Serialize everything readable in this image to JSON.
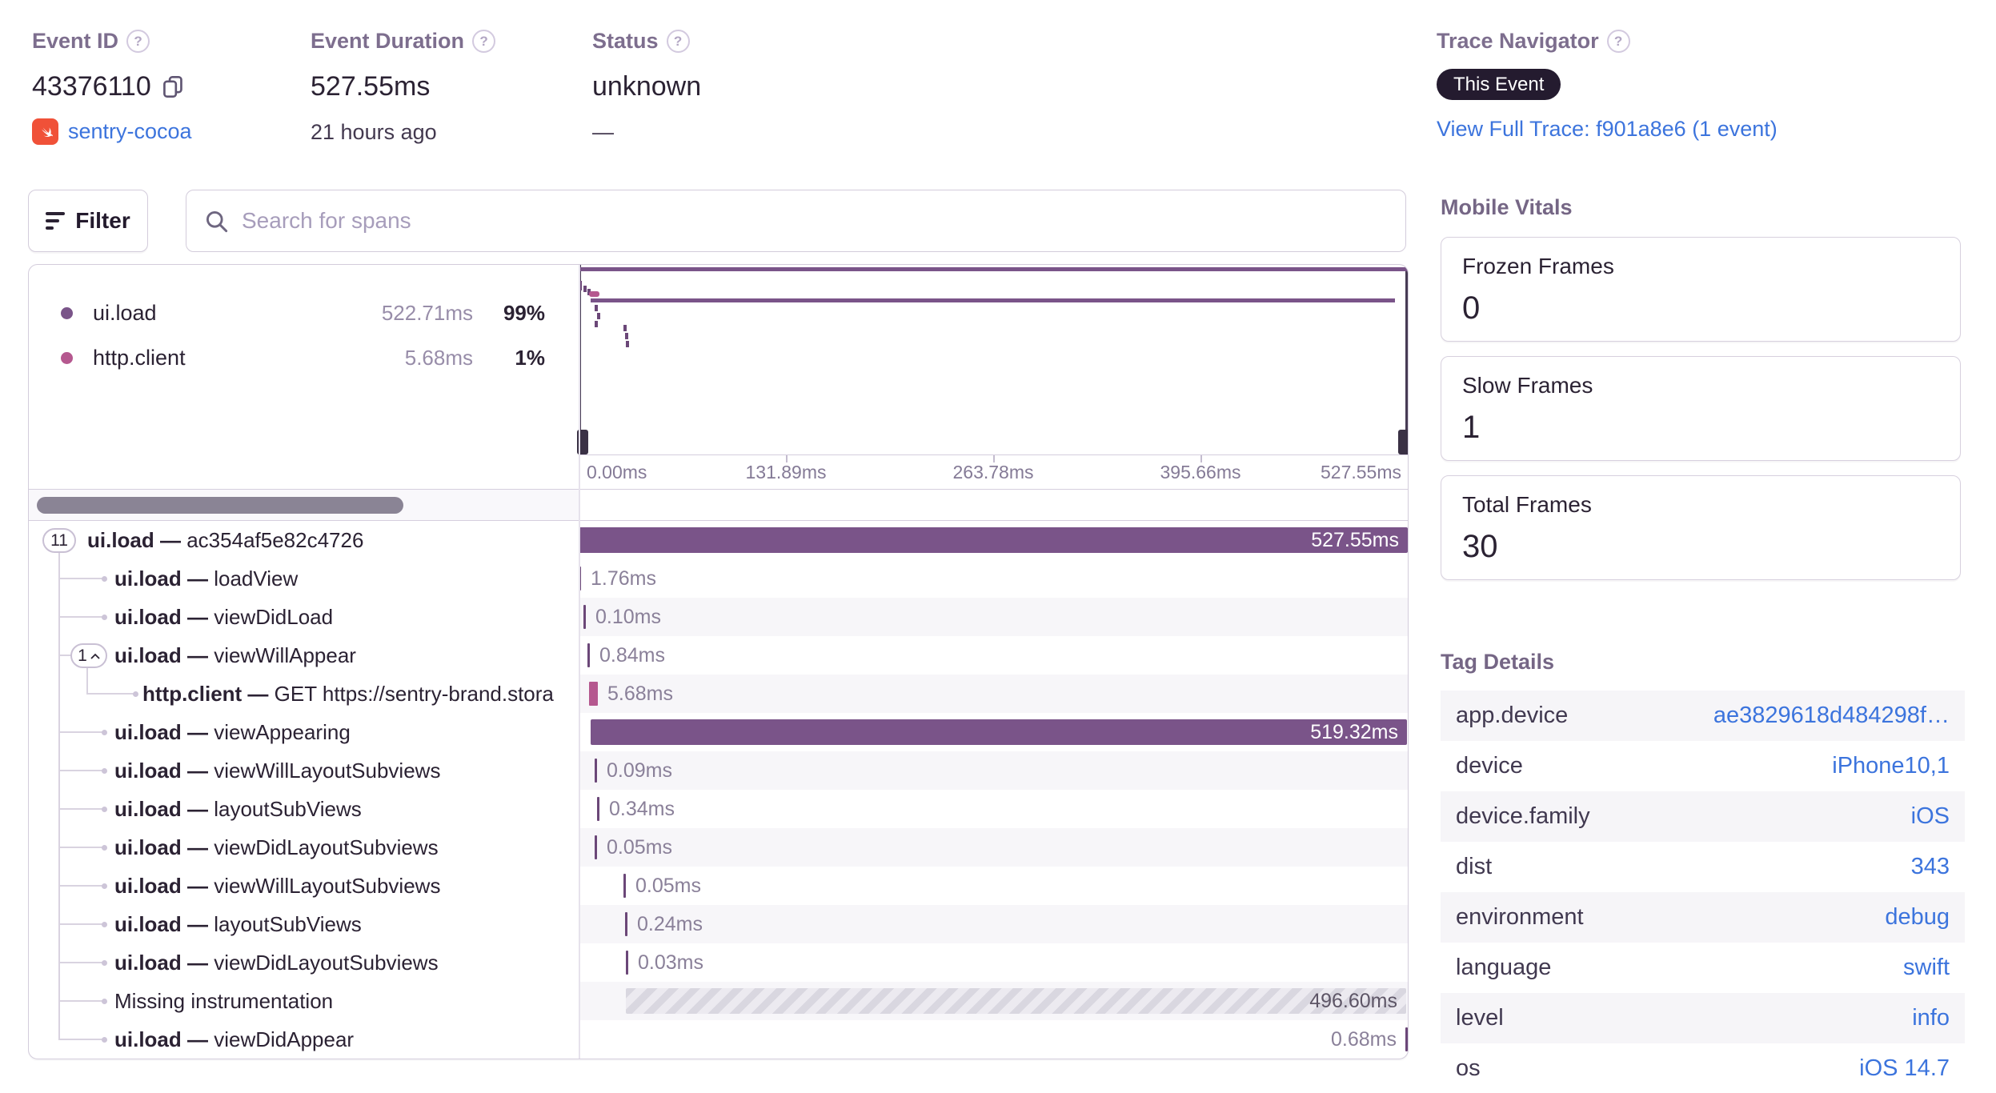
{
  "header": {
    "event_id": {
      "label": "Event ID",
      "value": "43376110",
      "project": "sentry-cocoa"
    },
    "event_duration": {
      "label": "Event Duration",
      "value": "527.55ms",
      "age": "21 hours ago"
    },
    "status": {
      "label": "Status",
      "value": "unknown",
      "sub": "—"
    },
    "trace_navigator": {
      "label": "Trace Navigator",
      "badge": "This Event",
      "link": "View Full Trace: f901a8e6 (1 event)"
    }
  },
  "toolbar": {
    "filter_label": "Filter",
    "search_placeholder": "Search for spans"
  },
  "chart_data": {
    "type": "span-waterfall",
    "total_ms": 527.55,
    "axis_ticks": [
      "0.00ms",
      "131.89ms",
      "263.78ms",
      "395.66ms",
      "527.55ms"
    ],
    "legend": [
      {
        "op": "ui.load",
        "duration": "522.71ms",
        "pct": "99%",
        "color": "#7a5489"
      },
      {
        "op": "http.client",
        "duration": "5.68ms",
        "pct": "1%",
        "color": "#b5588f"
      }
    ],
    "spans": [
      {
        "op": "ui.load",
        "desc": "ac354af5e82c4726",
        "duration_label": "527.55ms",
        "duration_ms": 527.55,
        "start_ms": 0,
        "kind": "bar",
        "pill": "11"
      },
      {
        "op": "ui.load",
        "desc": "loadView",
        "duration_label": "1.76ms",
        "duration_ms": 1.76,
        "start_ms": 0,
        "kind": "tick"
      },
      {
        "op": "ui.load",
        "desc": "viewDidLoad",
        "duration_label": "0.10ms",
        "duration_ms": 0.1,
        "start_ms": 3.0,
        "kind": "tick"
      },
      {
        "op": "ui.load",
        "desc": "viewWillAppear",
        "duration_label": "0.84ms",
        "duration_ms": 0.84,
        "start_ms": 5.6,
        "kind": "tick",
        "pill": "1",
        "pill_chevron": true
      },
      {
        "op": "http.client",
        "desc": "GET https://sentry-brand.stora",
        "duration_label": "5.68ms",
        "duration_ms": 5.68,
        "start_ms": 6.6,
        "kind": "tick",
        "color": "pink",
        "child": true
      },
      {
        "op": "ui.load",
        "desc": "viewAppearing",
        "duration_label": "519.32ms",
        "duration_ms": 519.32,
        "start_ms": 7.6,
        "kind": "bar"
      },
      {
        "op": "ui.load",
        "desc": "viewWillLayoutSubviews",
        "duration_label": "0.09ms",
        "duration_ms": 0.09,
        "start_ms": 10.2,
        "kind": "tick"
      },
      {
        "op": "ui.load",
        "desc": "layoutSubViews",
        "duration_label": "0.34ms",
        "duration_ms": 0.34,
        "start_ms": 11.7,
        "kind": "tick"
      },
      {
        "op": "ui.load",
        "desc": "viewDidLayoutSubviews",
        "duration_label": "0.05ms",
        "duration_ms": 0.05,
        "start_ms": 10.2,
        "kind": "tick"
      },
      {
        "op": "ui.load",
        "desc": "viewWillLayoutSubviews",
        "duration_label": "0.05ms",
        "duration_ms": 0.05,
        "start_ms": 28.5,
        "kind": "tick"
      },
      {
        "op": "ui.load",
        "desc": "layoutSubViews",
        "duration_label": "0.24ms",
        "duration_ms": 0.24,
        "start_ms": 29.5,
        "kind": "tick"
      },
      {
        "op": "ui.load",
        "desc": "viewDidLayoutSubviews",
        "duration_label": "0.03ms",
        "duration_ms": 0.03,
        "start_ms": 30.0,
        "kind": "tick"
      },
      {
        "op": "",
        "desc": "Missing instrumentation",
        "duration_label": "496.60ms",
        "duration_ms": 496.6,
        "start_ms": 30.2,
        "kind": "hatched"
      },
      {
        "op": "ui.load",
        "desc": "viewDidAppear",
        "duration_label": "0.68ms",
        "duration_ms": 0.68,
        "start_ms": 526.5,
        "kind": "tick-end"
      }
    ]
  },
  "mobile_vitals": {
    "title": "Mobile Vitals",
    "cards": [
      {
        "label": "Frozen Frames",
        "value": "0"
      },
      {
        "label": "Slow Frames",
        "value": "1"
      },
      {
        "label": "Total Frames",
        "value": "30"
      }
    ]
  },
  "tag_details": {
    "title": "Tag Details",
    "rows": [
      {
        "key": "app.device",
        "value": "ae3829618d484298f…"
      },
      {
        "key": "device",
        "value": "iPhone10,1"
      },
      {
        "key": "device.family",
        "value": "iOS"
      },
      {
        "key": "dist",
        "value": "343"
      },
      {
        "key": "environment",
        "value": "debug"
      },
      {
        "key": "language",
        "value": "swift"
      },
      {
        "key": "level",
        "value": "info"
      },
      {
        "key": "os",
        "value": "iOS 14.7"
      }
    ]
  },
  "colors": {
    "purple": "#7a5489",
    "purple_dark": "#6b4778",
    "pink": "#b5588f",
    "link": "#3c74dd",
    "dark": "#2b2233"
  }
}
